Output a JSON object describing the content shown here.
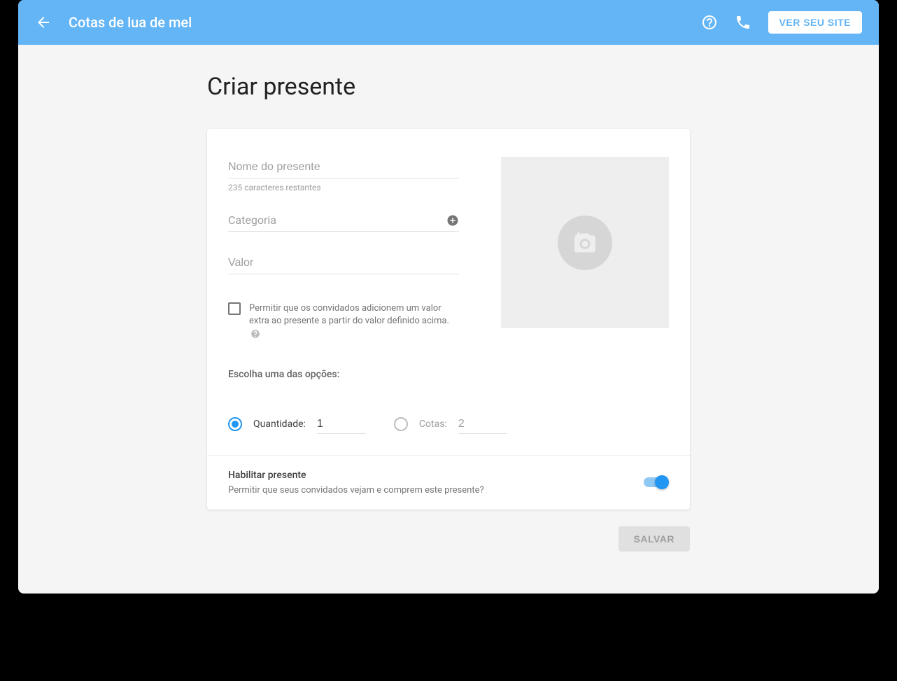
{
  "header": {
    "title": "Cotas de lua de mel",
    "view_site_btn": "VER SEU SITE"
  },
  "page": {
    "title": "Criar presente"
  },
  "form": {
    "name_placeholder": "Nome do presente",
    "name_helper": "235 caracteres restantes",
    "category_label": "Categoria",
    "value_placeholder": "Valor",
    "extra_checkbox_label": "Permitir que os convidados adicionem um valor extra ao presente a partir do valor definido acima.",
    "options_label": "Escolha uma das opções:",
    "quantity_label": "Quantidade:",
    "quantity_value": "1",
    "cotas_label": "Cotas:",
    "cotas_value": "2"
  },
  "footer": {
    "title": "Habilitar presente",
    "subtitle": "Permitir que seus convidados vejam e comprem este presente?"
  },
  "actions": {
    "save": "SALVAR"
  }
}
